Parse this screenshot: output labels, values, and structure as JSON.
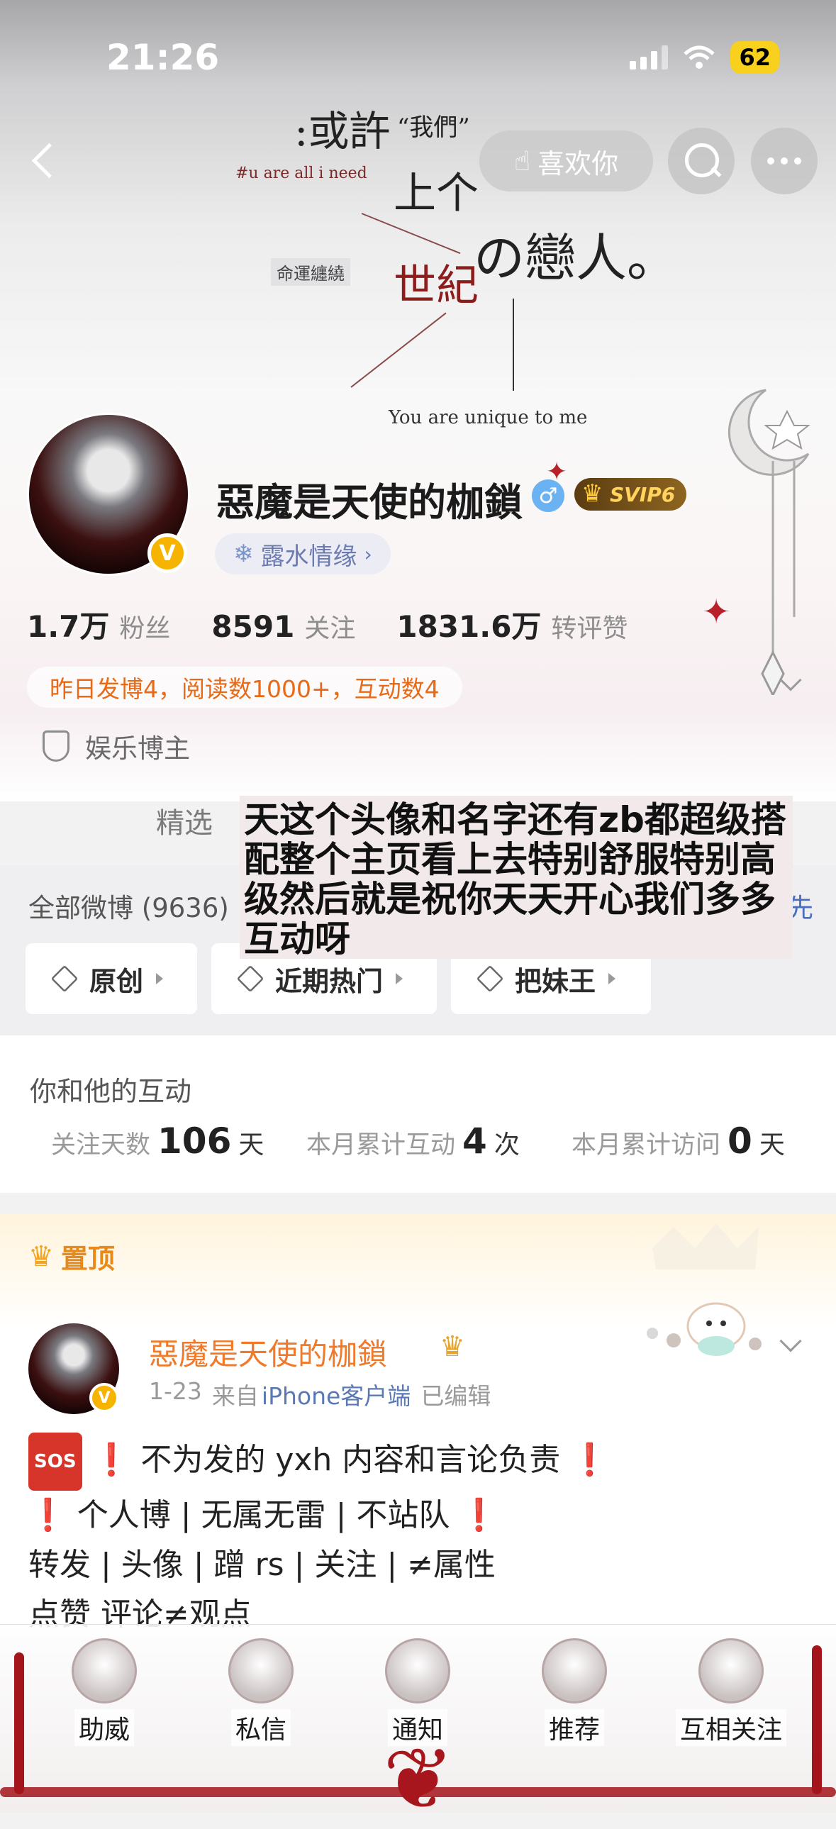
{
  "status_bar": {
    "time": "21:26",
    "battery": "62"
  },
  "header": {
    "like_label": "喜欢你",
    "banner_art": {
      "line1": ":或許",
      "line2": "“我們”",
      "line3": "#u are all i need",
      "line4": "上个",
      "line5": "世紀",
      "line6": "の戀人。",
      "line7": "命運纏繞",
      "line8": "You are unique to me"
    }
  },
  "profile": {
    "name": "惡魔是天使的枷鎖",
    "gender_symbol": "♂",
    "vip_label": "SVIP6",
    "avatar_badge": "V",
    "tag": "露水情缘",
    "tag_icon": "❄",
    "stats": [
      {
        "value": "1.7万",
        "label": "粉丝"
      },
      {
        "value": "8591",
        "label": "关注"
      },
      {
        "value": "1831.6万",
        "label": "转评赞"
      }
    ],
    "activity": "昨日发博4，阅读数1000+，互动数4",
    "certification": "娱乐博主"
  },
  "tabs": {
    "featured": "精选"
  },
  "overlay_text": "天这个头像和名字还有zb都超级搭配整个主页看上去特别舒服特别高级然后就是祝你天天开心我们多多互动呀",
  "weibo": {
    "all_label": "全部微博 (9636)",
    "right_link": "先",
    "filters": [
      "原创",
      "近期热门",
      "把妹王"
    ]
  },
  "interaction": {
    "title": "你和他的互动",
    "metrics": [
      {
        "label": "关注天数",
        "value": "106",
        "unit": "天"
      },
      {
        "label": "本月累计互动",
        "value": "4",
        "unit": "次"
      },
      {
        "label": "本月累计访问",
        "value": "0",
        "unit": "天"
      }
    ]
  },
  "pinned": {
    "label": "置顶",
    "author": "惡魔是天使的枷鎖",
    "author_badge": "V",
    "date": "1-23",
    "source_prefix": "来自",
    "source": "iPhone客户端",
    "edited": "已编辑",
    "sos": "SOS",
    "lines": [
      {
        "pre": "❗",
        "text": " 不为发的 yxh 内容和言论负责 ",
        "post": "❗"
      },
      {
        "pre": "❗",
        "text": " 个人博 | 无属无雷 | 不站队 ",
        "post": "❗"
      },
      {
        "pre": "",
        "text": "转发 | 头像 | 蹭 rs | 关注 | ≠属性",
        "post": ""
      },
      {
        "pre": "",
        "text": "点赞 评论≠观点",
        "post": ""
      }
    ]
  },
  "bottom_nav": [
    "助威",
    "私信",
    "通知",
    "推荐",
    "互相关注"
  ]
}
